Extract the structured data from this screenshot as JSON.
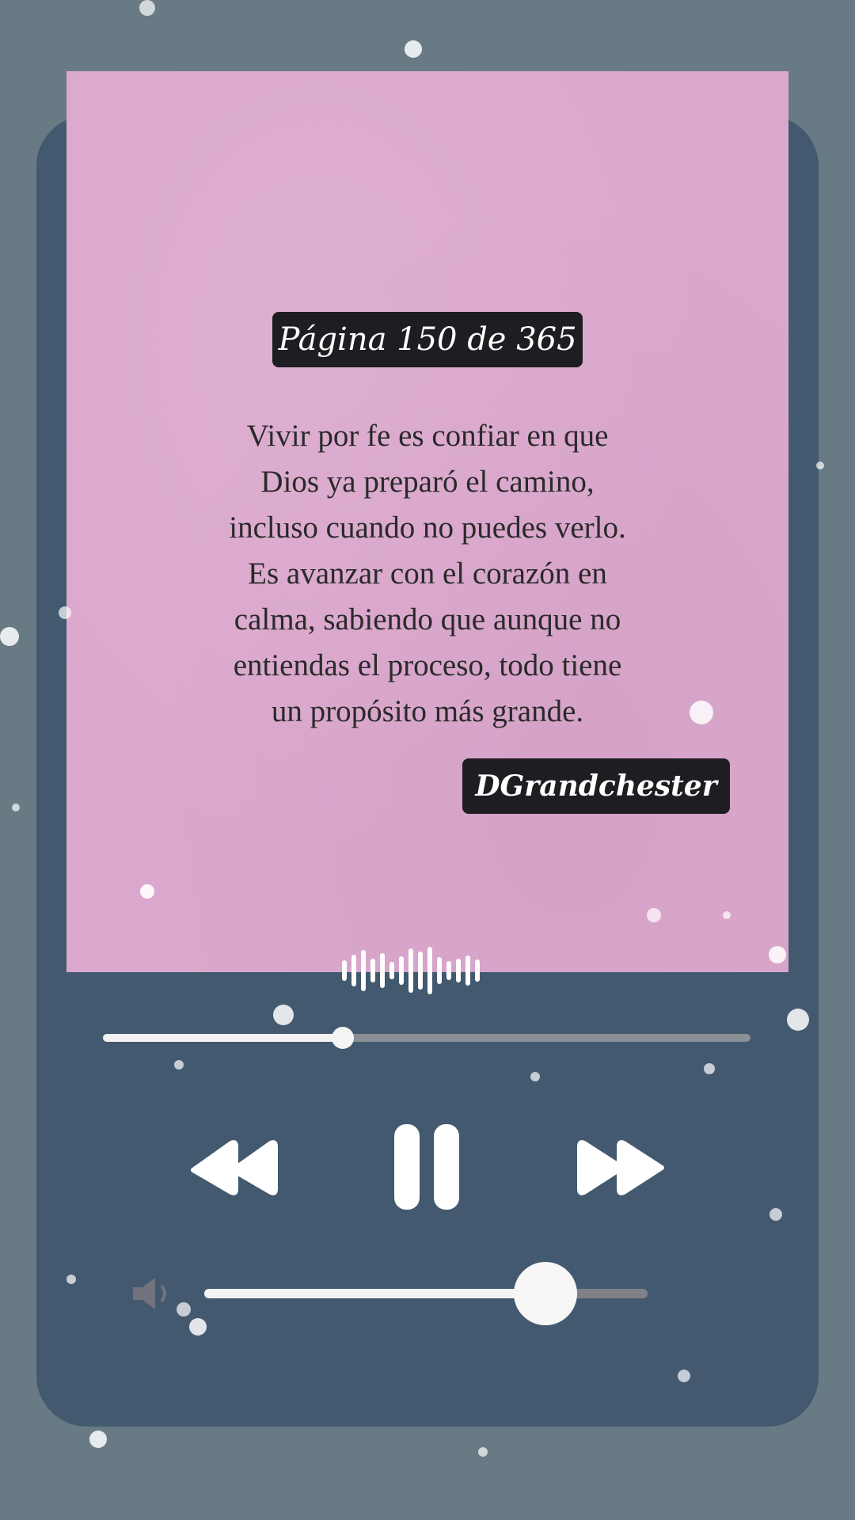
{
  "cover": {
    "page_label": "Página 150 de 365",
    "quote_lines": [
      "Vivir por fe es confiar en que",
      "Dios ya preparó el camino,",
      "incluso cuando no puedes verlo.",
      "Es avanzar con el corazón en",
      "calma, sabiendo que aunque no",
      "entiendas el proceso, todo tiene",
      "un propósito más grande."
    ],
    "author": "DGrandchester",
    "background_color": "#dba8cd"
  },
  "player": {
    "card_color": "#43596f",
    "progress_fraction": 0.37,
    "volume_fraction": 0.77,
    "controls": {
      "rewind_icon": "rewind-icon",
      "pause_icon": "pause-icon",
      "forward_icon": "fast-forward-icon",
      "volume_icon": "speaker-icon"
    }
  }
}
